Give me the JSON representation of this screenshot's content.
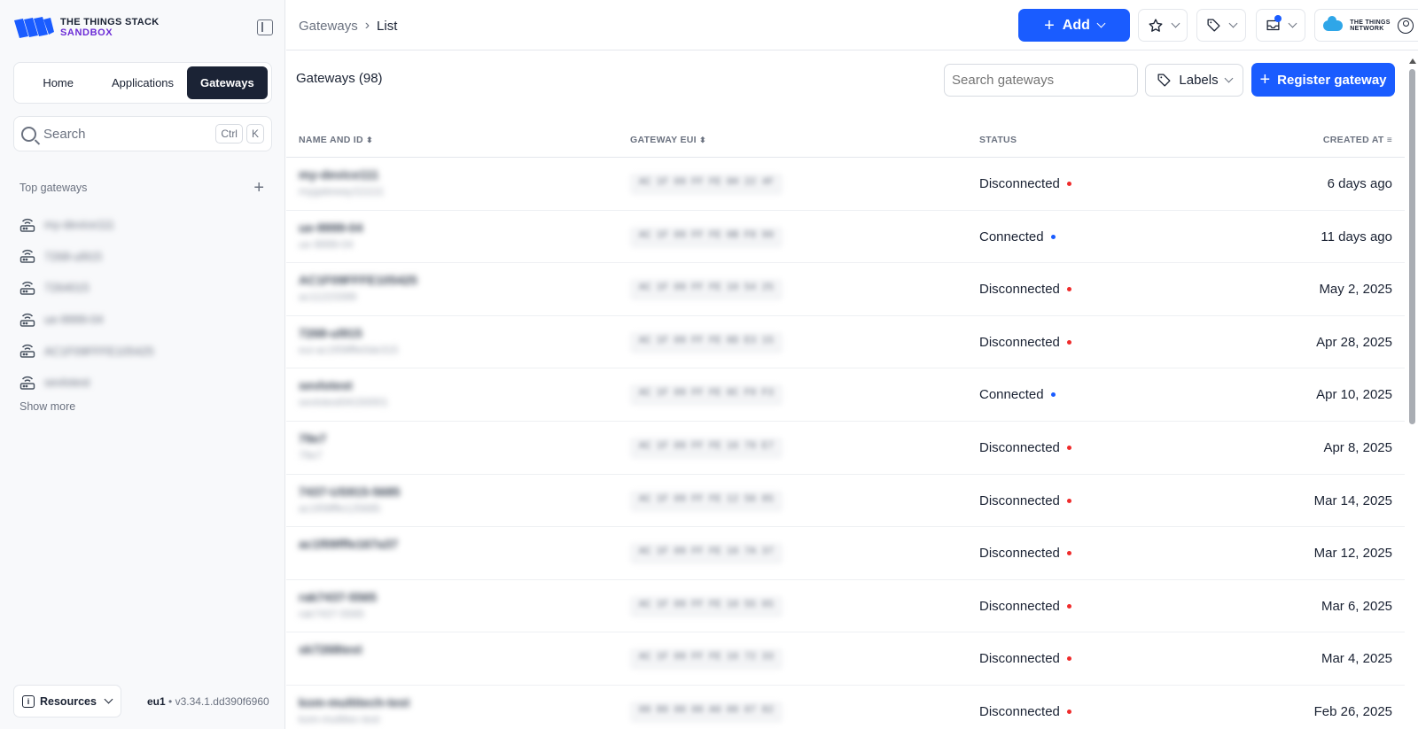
{
  "logo": {
    "line1": "THE THINGS STACK",
    "line2": "SANDBOX"
  },
  "nav": {
    "items": [
      "Home",
      "Applications",
      "Gateways"
    ],
    "active": "Gateways"
  },
  "sidebar_search": {
    "placeholder": "Search",
    "kbd1": "Ctrl",
    "kbd2": "K"
  },
  "top_gateways": {
    "title": "Top gateways",
    "items": [
      "my-device111",
      "7268-ul915",
      "7264015",
      "ue-9999-04",
      "AC1F09FFFE105425",
      "sevlotest"
    ],
    "show_more": "Show more"
  },
  "footer": {
    "resources_label": "Resources",
    "cluster": "eu1",
    "version": "v3.34.1.dd390f6960"
  },
  "topbar": {
    "breadcrumb": [
      "Gateways",
      "List"
    ],
    "add_label": "Add",
    "ttn_logo": [
      "THE THINGS",
      "NETWORK"
    ]
  },
  "main": {
    "title": "Gateways (98)",
    "search_placeholder": "Search gateways",
    "labels_button": "Labels",
    "register_button": "Register gateway"
  },
  "table": {
    "columns": [
      "NAME AND ID",
      "GATEWAY EUI",
      "STATUS",
      "CREATED AT"
    ],
    "rows": [
      {
        "name": "my-device111",
        "id": "mygateway111111",
        "eui": "AC 1F 09 FF FE 0H 22 4F",
        "status": "Disconnected",
        "created": "6 days ago"
      },
      {
        "name": "ue-9999-04",
        "id": "ue-9999-04",
        "eui": "AC 1F 09 FF FE 0B F8 99",
        "status": "Connected",
        "created": "11 days ago"
      },
      {
        "name": "AC1F09FFFE105425",
        "id": "ac11223399",
        "eui": "AC 1F 09 FF FE 10 54 25",
        "status": "Disconnected",
        "created": "May 2, 2025"
      },
      {
        "name": "7268-ul915",
        "id": "eui-ac1f09fffe0de315",
        "eui": "AC 1F 09 FF FE 0D E3 15",
        "status": "Disconnected",
        "created": "Apr 28, 2025"
      },
      {
        "name": "sevlotest",
        "id": "sevlotest04150001",
        "eui": "AC 1F 09 FF FE 0C F9 F3",
        "status": "Connected",
        "created": "Apr 10, 2025"
      },
      {
        "name": "79e7",
        "id": "79e7",
        "eui": "AC 1F 09 FF FE 16 79 E7",
        "status": "Disconnected",
        "created": "Apr 8, 2025"
      },
      {
        "name": "7437-US915-5685",
        "id": "ac1f09fffe125685",
        "eui": "AC 1F 09 FF FE 12 56 85",
        "status": "Disconnected",
        "created": "Mar 14, 2025"
      },
      {
        "name": "ac1f09fffe167a37",
        "id": "",
        "eui": "AC 1F 09 FF FE 16 7A 37",
        "status": "Disconnected",
        "created": "Mar 12, 2025"
      },
      {
        "name": "rak7437-5565",
        "id": "rak7437-5565",
        "eui": "AC 1F 09 FF FE 10 55 65",
        "status": "Disconnected",
        "created": "Mar 6, 2025"
      },
      {
        "name": "sk7268test",
        "id": "",
        "eui": "AC 1F 09 FF FE 16 72 33",
        "status": "Disconnected",
        "created": "Mar 4, 2025"
      },
      {
        "name": "kom-multitech-test",
        "id": "kom-multitec-test",
        "eui": "00 80 00 00 A0 00 07 82",
        "status": "Disconnected",
        "created": "Feb 26, 2025"
      }
    ]
  },
  "colors": {
    "accent": "#1a5cff",
    "disconnected": "#ef2b2b",
    "connected": "#1a5cff",
    "nav_active": "#1b2335"
  }
}
